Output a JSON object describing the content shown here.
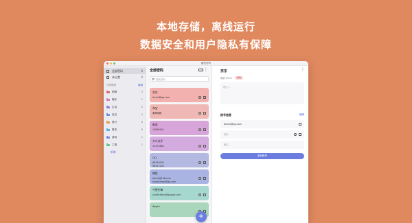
{
  "headline": {
    "line1": "本地存储，离线运行",
    "line2": "数据安全和用户隐私有保障"
  },
  "window": {
    "title": "藏密密码"
  },
  "sidebar": {
    "items": [
      {
        "label": "全部密码",
        "count": "8"
      },
      {
        "label": "未分类",
        "count": "0"
      }
    ],
    "categories_header": "分类管理",
    "edit_label": "编辑",
    "categories": [
      {
        "label": "购物",
        "count": "2",
        "color": "#E06A6A"
      },
      {
        "label": "娱乐",
        "count": "1",
        "color": "#D87AC2"
      },
      {
        "label": "生活",
        "count": "2",
        "color": "#8E7FD9"
      },
      {
        "label": "社交",
        "count": "2",
        "color": "#6E8FE0"
      },
      {
        "label": "旅行",
        "count": "0",
        "color": "#E39A4F"
      },
      {
        "label": "财务",
        "count": "0",
        "color": "#5BB0E3"
      },
      {
        "label": "游戏",
        "count": "1",
        "color": "#7A8AD6"
      },
      {
        "label": "工具",
        "count": "1",
        "color": "#6CC48A"
      }
    ],
    "add_label": "新增"
  },
  "list": {
    "title": "全部密码",
    "search_placeholder": "搜索密码",
    "cards": [
      {
        "name": "京东",
        "account": "farahi@qq.com",
        "color": "#F2B1AE"
      },
      {
        "name": "淘宝",
        "account": "麦辣鸡翅",
        "color": "#F0B8B4"
      },
      {
        "name": "新浪",
        "account": "15080941",
        "color": "#D7A5D9"
      },
      {
        "name": "大众点评",
        "account": "15373882",
        "color": "#D3ABDE"
      },
      {
        "name": "QQ",
        "account": "66343094\n98221240",
        "color": "#B4B9E2"
      },
      {
        "name": "微信",
        "account": "demo@126.com\nhaotothiest@qq.com",
        "color": "#A9B4E2"
      },
      {
        "name": "守望先锋",
        "account": "justflicktest@google.com",
        "color": "#A6D8CF"
      },
      {
        "name": "Apple",
        "account": "",
        "color": "#A9D6BD"
      }
    ]
  },
  "detail": {
    "title": "京东",
    "meta": "更新 09:21",
    "tag": "购物",
    "notes_placeholder": "备注...",
    "section_title": "账号信息",
    "edit_label": "编辑",
    "account_value": "farahi@qq.com",
    "password_placeholder": "密码",
    "remark_placeholder": "备注",
    "add_account_label": "添加账号"
  },
  "accent": "#6B7EE0"
}
